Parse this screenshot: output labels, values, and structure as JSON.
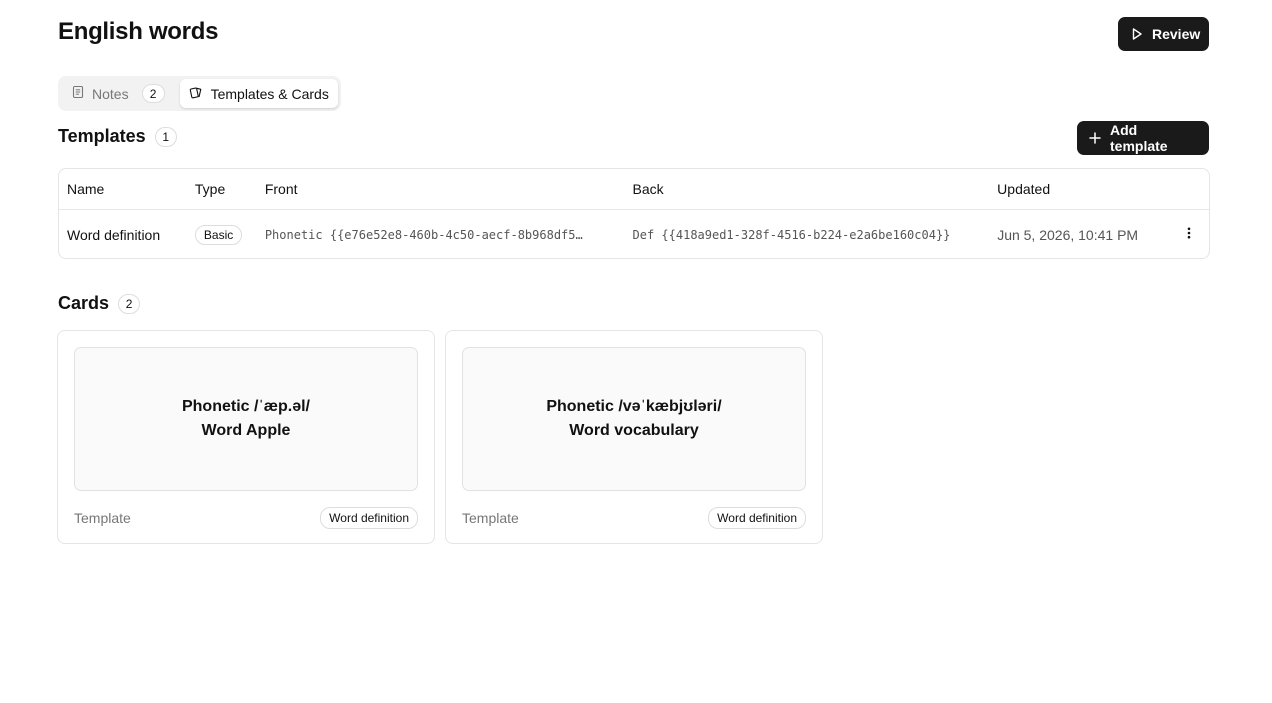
{
  "page": {
    "title": "English words"
  },
  "header": {
    "review_label": "Review"
  },
  "tabs": [
    {
      "label": "Notes",
      "count": "2",
      "icon": "note-icon",
      "active": false
    },
    {
      "label": "Templates & Cards",
      "icon": "cards-icon",
      "active": true
    }
  ],
  "templates": {
    "title": "Templates",
    "count": "1",
    "add_label": "Add template",
    "columns": [
      "Name",
      "Type",
      "Front",
      "Back",
      "Updated"
    ],
    "rows": [
      {
        "name": "Word definition",
        "type": "Basic",
        "front": "Phonetic {{e76e52e8-460b-4c50-aecf-8b968df5…",
        "back": "Def {{418a9ed1-328f-4516-b224-e2a6be160c04}}",
        "updated": "Jun 5, 2026, 10:41 PM",
        "menu_icon": "more-vertical-icon"
      }
    ]
  },
  "cards": {
    "title": "Cards",
    "count": "2",
    "items": [
      {
        "line1": "Phonetic /ˈæp.əl/",
        "line2": "Word Apple",
        "footer_label": "Template",
        "template_name": "Word definition"
      },
      {
        "line1": "Phonetic /vəˈkæbjʊləri/",
        "line2": "Word vocabulary",
        "footer_label": "Template",
        "template_name": "Word definition"
      }
    ]
  },
  "colors": {
    "primary_button": "#1a1a1a",
    "border": "#e5e5e5",
    "muted_text": "#777777"
  }
}
